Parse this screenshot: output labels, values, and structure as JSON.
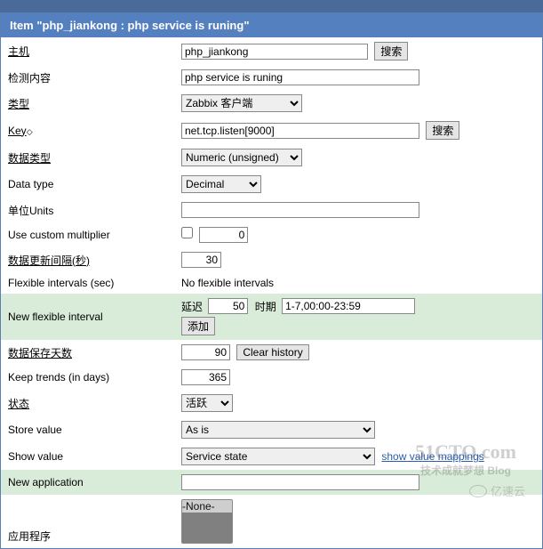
{
  "header": {
    "title": "Item \"php_jiankong : php service is runing\""
  },
  "rows": {
    "host": {
      "label": "主机",
      "value": "php_jiankong",
      "button": "搜索"
    },
    "description": {
      "label": "检测内容",
      "value": "php service is runing"
    },
    "type": {
      "label": "类型",
      "value": "Zabbix 客户端"
    },
    "key": {
      "label": "Key",
      "suffix_icon": "◇",
      "value": "net.tcp.listen[9000]",
      "button": "搜索"
    },
    "value_type": {
      "label": "数据类型",
      "value": "Numeric (unsigned)"
    },
    "data_type": {
      "label": "Data type",
      "value": "Decimal"
    },
    "units": {
      "label": "单位Units",
      "value": ""
    },
    "multiplier": {
      "label": "Use custom multiplier",
      "checked": false,
      "value": "0"
    },
    "delay": {
      "label": "数据更新间隔(秒)",
      "value": "30"
    },
    "flex_intervals": {
      "label": "Flexible intervals (sec)",
      "text": "No flexible intervals"
    },
    "new_flex": {
      "label": "New flexible interval",
      "delay_label": "延迟",
      "delay_value": "50",
      "period_label": "时期",
      "period_value": "1-7,00:00-23:59",
      "add_button": "添加"
    },
    "history": {
      "label": "数据保存天数",
      "value": "90",
      "button": "Clear history"
    },
    "trends": {
      "label": "Keep trends (in days)",
      "value": "365"
    },
    "status": {
      "label": "状态",
      "value": "活跃"
    },
    "store_value": {
      "label": "Store value",
      "value": "As is"
    },
    "show_value": {
      "label": "Show value",
      "value": "Service state",
      "link": "show value mappings"
    },
    "new_app": {
      "label": "New application",
      "value": ""
    },
    "applications": {
      "label": "应用程序",
      "value": "-None-"
    }
  },
  "watermarks": {
    "w1": "51CTO.com",
    "w1b": "技术成就梦想  Blog",
    "w2": "亿速云"
  }
}
